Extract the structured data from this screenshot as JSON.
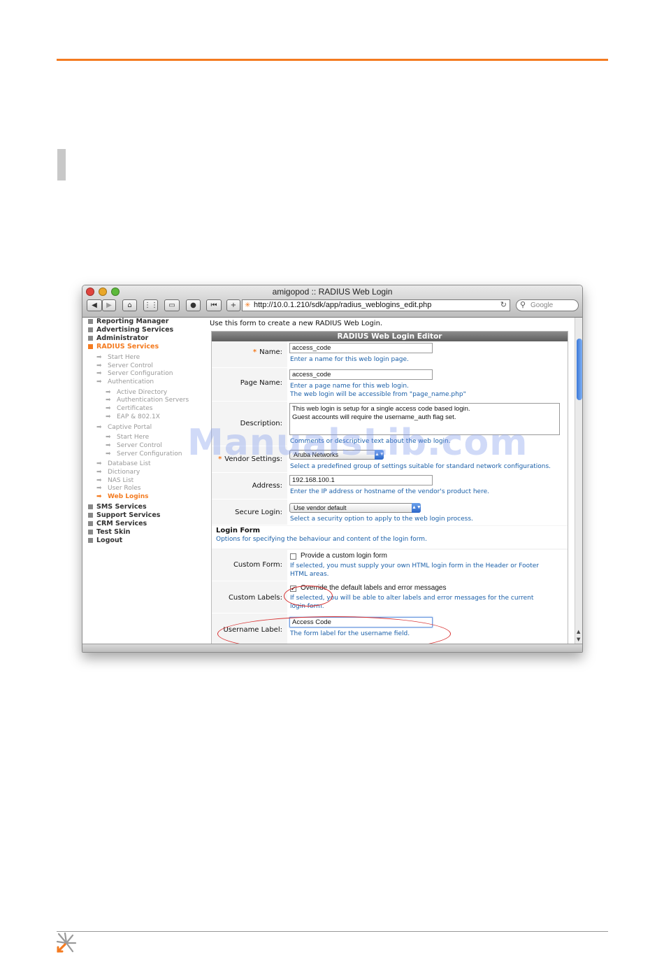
{
  "window": {
    "title": "amigopod :: RADIUS Web Login",
    "url": "http://10.0.1.210/sdk/app/radius_weblogins_edit.php",
    "search_placeholder": "Google"
  },
  "nav": {
    "items": [
      {
        "label": "Reporting Manager"
      },
      {
        "label": "Advertising Services"
      },
      {
        "label": "Administrator"
      },
      {
        "label": "RADIUS Services"
      }
    ],
    "radius_sub": [
      {
        "label": "Start Here",
        "level": 1
      },
      {
        "label": "Server Control",
        "level": 1
      },
      {
        "label": "Server Configuration",
        "level": 1
      },
      {
        "label": "Authentication",
        "level": 1
      },
      {
        "label": "Active Directory",
        "level": 2
      },
      {
        "label": "Authentication Servers",
        "level": 2
      },
      {
        "label": "Certificates",
        "level": 2
      },
      {
        "label": "EAP & 802.1X",
        "level": 2
      },
      {
        "label": "Captive Portal",
        "level": 1
      },
      {
        "label": "Start Here",
        "level": 2
      },
      {
        "label": "Server Control",
        "level": 2
      },
      {
        "label": "Server Configuration",
        "level": 2
      },
      {
        "label": "Database List",
        "level": 1
      },
      {
        "label": "Dictionary",
        "level": 1
      },
      {
        "label": "NAS List",
        "level": 1
      },
      {
        "label": "User Roles",
        "level": 1
      },
      {
        "label": "Web Logins",
        "level": 1
      }
    ],
    "items_after": [
      {
        "label": "SMS Services"
      },
      {
        "label": "Support Services"
      },
      {
        "label": "CRM Services"
      },
      {
        "label": "Test Skin"
      },
      {
        "label": "Logout"
      }
    ]
  },
  "form": {
    "intro": "Use this form to create a new RADIUS Web Login.",
    "title": "RADIUS Web Login Editor",
    "name": {
      "label": "Name:",
      "value": "access_code",
      "help": "Enter a name for this web login page."
    },
    "page_name": {
      "label": "Page Name:",
      "value": "access_code",
      "help1": "Enter a page name for this web login.",
      "help2": "The web login will be accessible from \"page_name.php\""
    },
    "description": {
      "label": "Description:",
      "line1": "This web login is setup for a single access code based login.",
      "line2": "Guest accounts will require the username_auth flag set.",
      "help": "Comments or descriptive text about the web login."
    },
    "vendor": {
      "label": "Vendor Settings:",
      "value": "Aruba Networks",
      "help": "Select a predefined group of settings suitable for standard network configurations."
    },
    "address": {
      "label": "Address:",
      "value": "192.168.100.1",
      "help": "Enter the IP address or hostname of the vendor's product here."
    },
    "secure_login": {
      "label": "Secure Login:",
      "value": "Use vendor default",
      "help": "Select a security option to apply to the web login process."
    },
    "login_form": {
      "title": "Login Form",
      "help": "Options for specifying the behaviour and content of the login form."
    },
    "custom_form": {
      "label": "Custom Form:",
      "checkbox_label": "Provide a custom login form",
      "help1": "If selected, you must supply your own HTML login form in the Header or Footer",
      "help2": "HTML areas."
    },
    "custom_labels": {
      "label": "Custom Labels:",
      "checkbox_label": "Override the default labels and error messages",
      "help1": "If selected, you will be able to alter labels and error messages for the current",
      "help2": "login form."
    },
    "username_label": {
      "label": "Username Label:",
      "value": "Access Code",
      "help": "The form label for the username field."
    }
  },
  "watermark": "ManualsLib.com"
}
